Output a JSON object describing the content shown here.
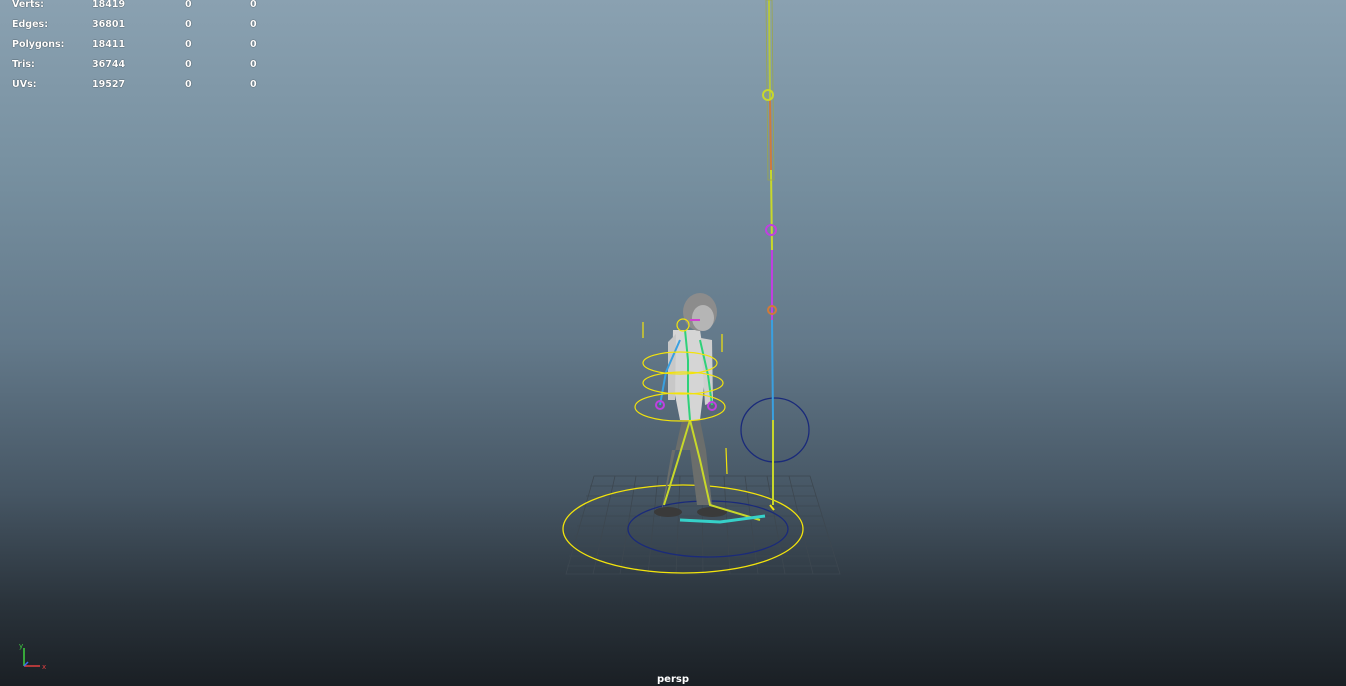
{
  "hud": {
    "rows": [
      {
        "label": "Verts:",
        "values": [
          "18419",
          "0",
          "0"
        ]
      },
      {
        "label": "Edges:",
        "values": [
          "36801",
          "0",
          "0"
        ]
      },
      {
        "label": "Polygons:",
        "values": [
          "18411",
          "0",
          "0"
        ]
      },
      {
        "label": "Tris:",
        "values": [
          "36744",
          "0",
          "0"
        ]
      },
      {
        "label": "UVs:",
        "values": [
          "19527",
          "0",
          "0"
        ]
      }
    ]
  },
  "viewport": {
    "camera_label": "persp",
    "axis": {
      "y_label": "y",
      "x_label": "x",
      "y_color": "#3fd13f",
      "x_color": "#e04040"
    }
  },
  "colors": {
    "control_yellow": "#f2e30c",
    "control_navy": "#1a2a7a",
    "grid": "#3d4750"
  }
}
